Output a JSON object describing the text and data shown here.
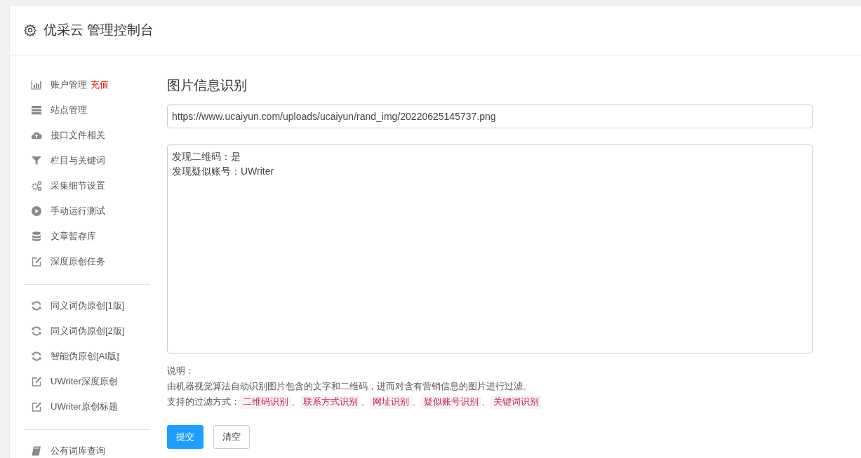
{
  "header": {
    "title": "优采云 管理控制台"
  },
  "sidebar": {
    "groups": [
      {
        "items": [
          {
            "label": "账户管理",
            "badge": "充值"
          },
          {
            "label": "站点管理"
          },
          {
            "label": "接口文件相关"
          },
          {
            "label": "栏目与关键词"
          },
          {
            "label": "采集细节设置"
          },
          {
            "label": "手动运行测试"
          },
          {
            "label": "文章暂存库"
          },
          {
            "label": "深度原创任务"
          }
        ]
      },
      {
        "items": [
          {
            "label": "同义词伪原创[1版]"
          },
          {
            "label": "同义词伪原创[2版]"
          },
          {
            "label": "智能伪原创[AI版]"
          },
          {
            "label": "UWriter深度原创"
          },
          {
            "label": "UWriter原创标题"
          }
        ]
      },
      {
        "items": [
          {
            "label": "公有词库查询"
          }
        ]
      }
    ]
  },
  "main": {
    "title": "图片信息识别",
    "url_field": {
      "value": "https://www.ucaiyun.com/uploads/ucaiyun/rand_img/20220625145737.png"
    },
    "result_field": {
      "lines": [
        "发现二维码：是",
        "发现疑似账号：UWriter"
      ]
    },
    "notes": {
      "heading": "说明：",
      "description": "由机器视觉算法自动识别图片包含的文字和二维码，进而对含有营销信息的图片进行过滤。",
      "methods_label": "支持的过滤方式：",
      "methods": [
        {
          "label": "二维码识别",
          "after": "、"
        },
        {
          "label": "联系方式识别",
          "after": "、"
        },
        {
          "label": "网址识别",
          "after": "、"
        },
        {
          "label": "疑似账号识别",
          "after": "、"
        },
        {
          "label": "关键词识别"
        }
      ]
    },
    "buttons": [
      {
        "label": "提交",
        "kind": "primary"
      },
      {
        "label": "清空",
        "kind": "default"
      }
    ]
  }
}
